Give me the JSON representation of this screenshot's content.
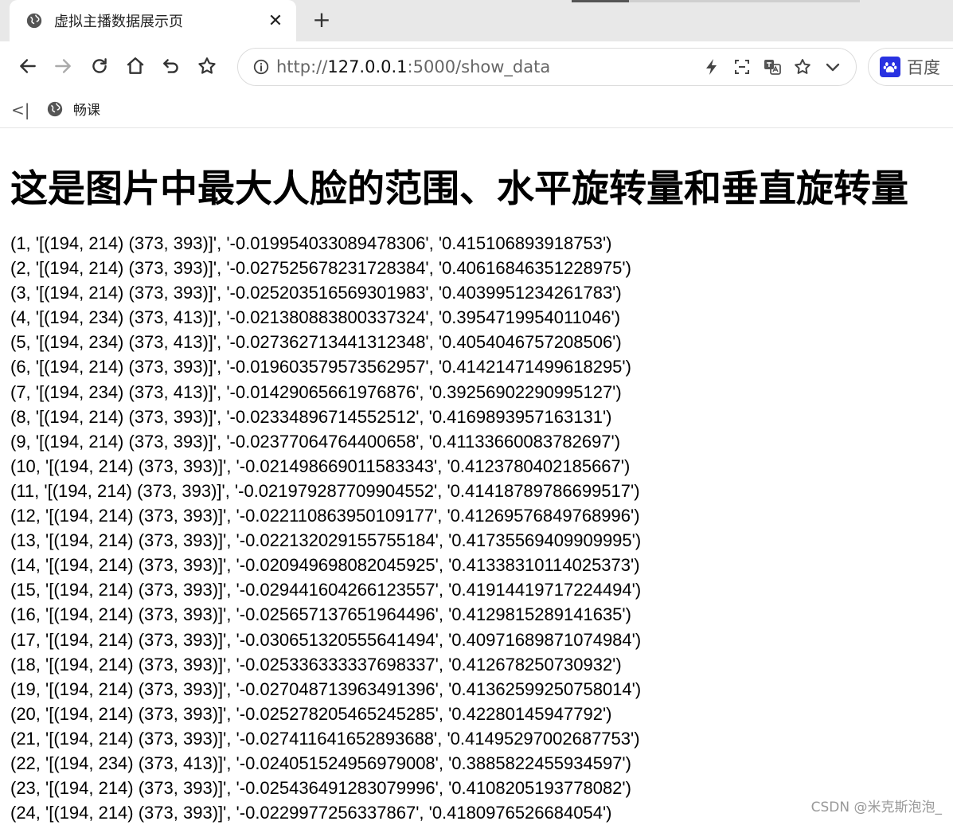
{
  "browser": {
    "tab_title": "虚拟主播数据展示页",
    "tab_close": "✕",
    "new_tab": "+",
    "url_prefix": "http://",
    "url_host": "127.0.0.1",
    "url_rest": ":5000/show_data",
    "search_label": "百度",
    "bookmark_toggle": "<|",
    "bookmark_label": "畅课"
  },
  "page": {
    "heading": "这是图片中最大人脸的范围、水平旋转量和垂直旋转量",
    "rows": [
      "(1, '[(194, 214) (373, 393)]', '-0.019954033089478306', '0.415106893918753')",
      "(2, '[(194, 214) (373, 393)]', '-0.027525678231728384', '0.40616846351228975')",
      "(3, '[(194, 214) (373, 393)]', '-0.025203516569301983', '0.4039951234261783')",
      "(4, '[(194, 234) (373, 413)]', '-0.021380883800337324', '0.3954719954011046')",
      "(5, '[(194, 234) (373, 413)]', '-0.027362713441312348', '0.4054046757208506')",
      "(6, '[(194, 214) (373, 393)]', '-0.019603579573562957', '0.41421471499618295')",
      "(7, '[(194, 234) (373, 413)]', '-0.01429065661976876', '0.39256902290995127')",
      "(8, '[(194, 214) (373, 393)]', '-0.02334896714552512', '0.4169893957163131')",
      "(9, '[(194, 214) (373, 393)]', '-0.02377064764400658', '0.41133660083782697')",
      "(10, '[(194, 214) (373, 393)]', '-0.021498669011583343', '0.4123780402185667')",
      "(11, '[(194, 214) (373, 393)]', '-0.021979287709904552', '0.41418789786699517')",
      "(12, '[(194, 214) (373, 393)]', '-0.022110863950109177', '0.41269576849768996')",
      "(13, '[(194, 214) (373, 393)]', '-0.022132029155755184', '0.41735569409909995')",
      "(14, '[(194, 214) (373, 393)]', '-0.020949698082045925', '0.41338310114025373')",
      "(15, '[(194, 214) (373, 393)]', '-0.029441604266123557', '0.41914419717224494')",
      "(16, '[(194, 214) (373, 393)]', '-0.025657137651964496', '0.4129815289141635')",
      "(17, '[(194, 214) (373, 393)]', '-0.030651320555641494', '0.40971689871074984')",
      "(18, '[(194, 214) (373, 393)]', '-0.025336333337698337', '0.412678250730932')",
      "(19, '[(194, 214) (373, 393)]', '-0.027048713963491396', '0.41362599250758014')",
      "(20, '[(194, 214) (373, 393)]', '-0.025278205465245285', '0.42280145947792')",
      "(21, '[(194, 214) (373, 393)]', '-0.027411641652893688', '0.41495297002687753')",
      "(22, '[(194, 234) (373, 413)]', '-0.024051524956979008', '0.3885822455934597')",
      "(23, '[(194, 214) (373, 393)]', '-0.025436491283079996', '0.4108205193778082')",
      "(24, '[(194, 214) (373, 393)]', '-0.0229977256337867', '0.4180976526684054')"
    ],
    "watermark": "CSDN @米克斯泡泡_"
  },
  "icons": {
    "favicon": "globe-icon",
    "back": "arrow-left-icon",
    "forward": "arrow-right-icon",
    "reload": "reload-icon",
    "home": "home-icon",
    "undo": "undo-icon",
    "favorite": "star-icon",
    "site_info": "info-icon",
    "accelerate": "lightning-icon",
    "screenshot": "screenshot-icon",
    "translate": "translate-icon",
    "bookmark_star": "star-icon",
    "dropdown": "chevron-down-icon",
    "search_engine": "baidu-paw-icon"
  },
  "colors": {
    "tab_strip": "#e8e8e8",
    "baidu_blue": "#2932e1"
  }
}
